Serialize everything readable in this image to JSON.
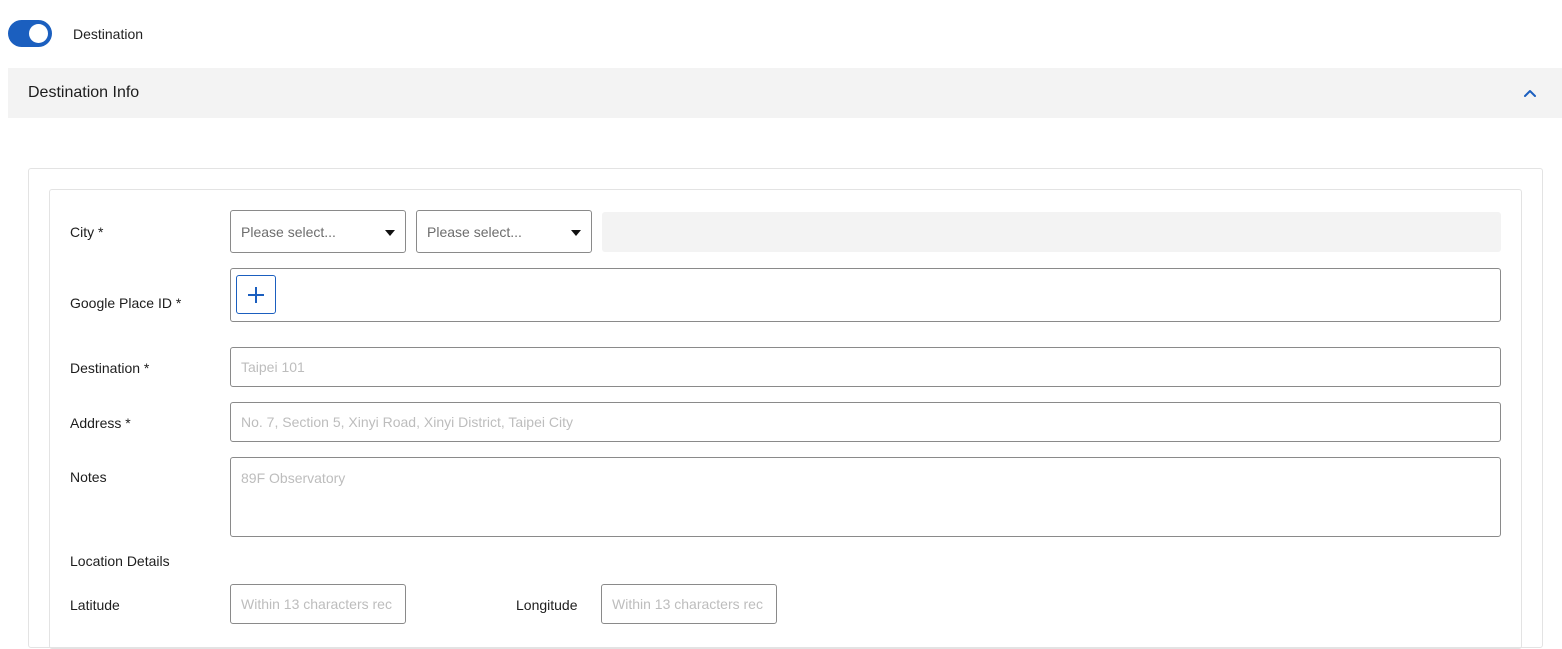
{
  "toggle": {
    "label": "Destination",
    "on": true,
    "color": "#1b5fbf"
  },
  "section": {
    "title": "Destination Info",
    "expanded": true
  },
  "form": {
    "city": {
      "label": "City *",
      "select1_value": "Please select...",
      "select2_value": "Please select..."
    },
    "google_place_id": {
      "label": "Google Place ID *",
      "add_icon": "plus-icon"
    },
    "destination": {
      "label": "Destination *",
      "placeholder": "Taipei 101"
    },
    "address": {
      "label": "Address *",
      "placeholder": "No. 7, Section 5, Xinyi Road, Xinyi District, Taipei City"
    },
    "notes": {
      "label": "Notes",
      "placeholder": "89F Observatory"
    },
    "location_details": {
      "label": "Location Details"
    },
    "latitude": {
      "label": "Latitude",
      "placeholder": "Within 13 characters rec"
    },
    "longitude": {
      "label": "Longitude",
      "placeholder": "Within 13 characters rec"
    }
  }
}
